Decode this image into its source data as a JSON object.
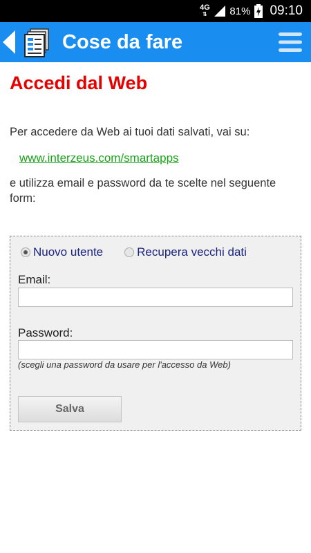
{
  "status_bar": {
    "network": "4G",
    "battery_percent": "81%",
    "time": "09:10"
  },
  "app_bar": {
    "title": "Cose da fare",
    "color": "#1a8df0",
    "icons": [
      "back-icon",
      "notes-app-icon",
      "menu-icon"
    ]
  },
  "content": {
    "page_title": "Accedi dal Web",
    "intro": "Per accedere da Web ai tuoi dati salvati, vai su:",
    "link": "www.interzeus.com/smartapps",
    "outro": "e utilizza email e password da te scelte nel seguente form:"
  },
  "form": {
    "radio_options": [
      {
        "label": "Nuovo utente",
        "checked": true
      },
      {
        "label": "Recupera vecchi dati",
        "checked": false
      }
    ],
    "email_label": "Email:",
    "email_value": "",
    "password_label": "Password:",
    "password_value": "",
    "password_hint": "(scegli una password da usare per l'accesso da Web)",
    "save_label": "Salva"
  }
}
